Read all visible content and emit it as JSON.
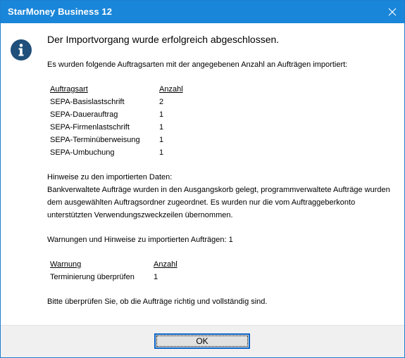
{
  "window": {
    "title": "StarMoney Business 12",
    "close_icon": "close-icon"
  },
  "message": {
    "icon": "info-icon",
    "heading": "Der Importvorgang wurde erfolgreich abgeschlossen.",
    "intro": "Es wurden folgende Auftragsarten mit der angegebenen Anzahl an Aufträgen importiert:",
    "orders_table": {
      "headers": [
        "Auftragsart",
        "Anzahl"
      ],
      "rows": [
        [
          "SEPA-Basislastschrift",
          "2"
        ],
        [
          "SEPA-Dauerauftrag",
          "1"
        ],
        [
          "SEPA-Firmenlastschrift",
          "1"
        ],
        [
          "SEPA-Terminüberweisung",
          "1"
        ],
        [
          "SEPA-Umbuchung",
          "1"
        ]
      ]
    },
    "notes_title": "Hinweise zu den importierten Daten:",
    "notes_line1": "Bankverwaltete Aufträge wurden in den Ausgangskorb gelegt, programmverwaltete Aufträge wurden",
    "notes_line2": "dem ausgewählten Auftragsordner zugeordnet. Es wurden nur die vom Auftraggeberkonto",
    "notes_line3": "unterstützten Verwendungszweckzeilen übernommen.",
    "warnings_summary": "Warnungen und Hinweise zu importierten Aufträgen: 1",
    "warnings_table": {
      "headers": [
        "Warnung",
        "Anzahl"
      ],
      "rows": [
        [
          "Terminierung überprüfen",
          "1"
        ]
      ]
    },
    "closing": "Bitte überprüfen Sie, ob die Aufträge richtig und vollständig sind."
  },
  "footer": {
    "ok_label": "OK"
  },
  "colors": {
    "titlebar": "#1a86d9",
    "icon": "#1f4f7a",
    "footer": "#f0f0f0",
    "button_border": "#0a64c8"
  }
}
